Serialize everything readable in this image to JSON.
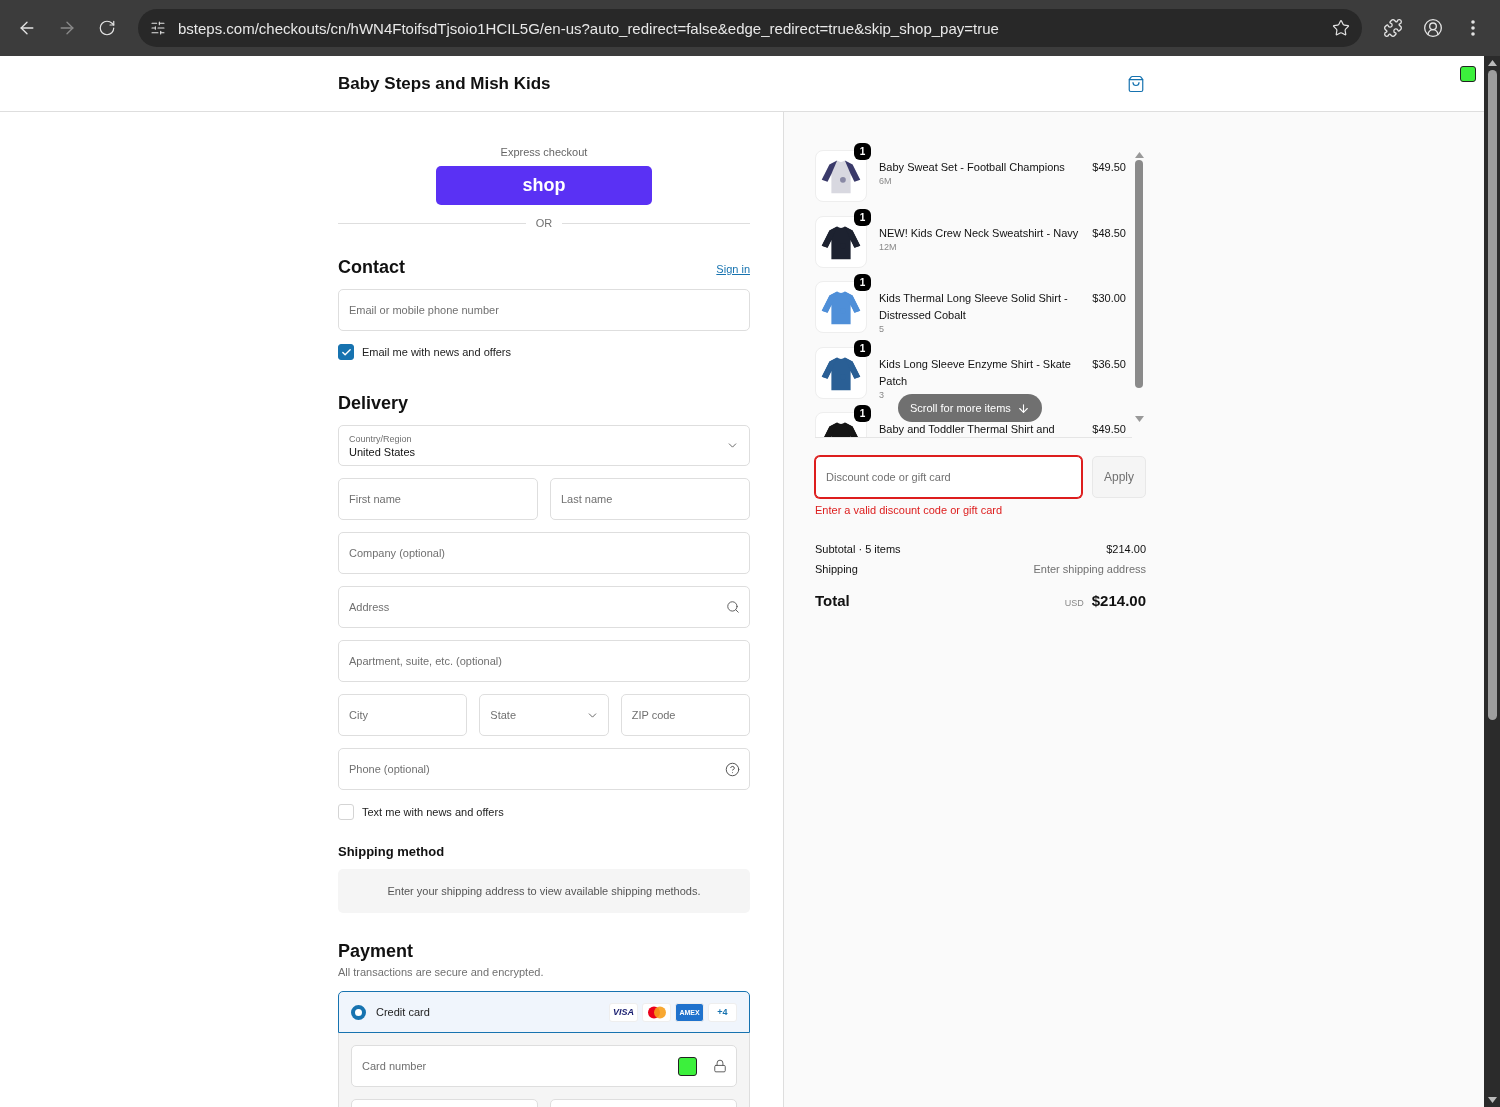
{
  "browser": {
    "url": "bsteps.com/checkouts/cn/hWN4FtoifsdTjsoio1HCIL5G/en-us?auto_redirect=false&edge_redirect=true&skip_shop_pay=true"
  },
  "store": {
    "name": "Baby Steps and Mish Kids"
  },
  "express": {
    "label": "Express checkout",
    "button": "shop",
    "divider": "OR"
  },
  "contact": {
    "heading": "Contact",
    "sign_in": "Sign in",
    "email_placeholder": "Email or mobile phone number",
    "newsletter": {
      "label": "Email me with news and offers",
      "checked": true
    }
  },
  "delivery": {
    "heading": "Delivery",
    "country": {
      "label": "Country/Region",
      "value": "United States"
    },
    "rows": [
      [
        {
          "kind": "text",
          "placeholder": "First name"
        },
        {
          "kind": "text",
          "placeholder": "Last name"
        }
      ],
      [
        {
          "kind": "text",
          "placeholder": "Company (optional)"
        }
      ],
      [
        {
          "kind": "search",
          "placeholder": "Address"
        }
      ],
      [
        {
          "kind": "text",
          "placeholder": "Apartment, suite, etc. (optional)"
        }
      ],
      [
        {
          "kind": "text",
          "placeholder": "City"
        },
        {
          "kind": "select",
          "placeholder": "State"
        },
        {
          "kind": "text",
          "placeholder": "ZIP code"
        }
      ],
      [
        {
          "kind": "help",
          "placeholder": "Phone (optional)"
        }
      ]
    ],
    "sms": {
      "label": "Text me with news and offers",
      "checked": false
    }
  },
  "shipping_method": {
    "heading": "Shipping method",
    "message": "Enter your shipping address to view available shipping methods."
  },
  "payment": {
    "heading": "Payment",
    "subtitle": "All transactions are secure and encrypted.",
    "methods": [
      {
        "label": "Credit card",
        "selected": true,
        "logos": [
          {
            "kind": "visa",
            "text": "VISA"
          },
          {
            "kind": "mastercard"
          },
          {
            "kind": "amex",
            "text": "AMEX"
          },
          {
            "kind": "more",
            "text": "+4"
          }
        ]
      }
    ],
    "card_number_placeholder": "Card number"
  },
  "summary": {
    "items": [
      {
        "quantity": "1",
        "name": "Baby Sweat Set - Football Champions",
        "variant": "6M",
        "price": "$49.50"
      },
      {
        "quantity": "1",
        "name": "NEW! Kids Crew Neck Sweatshirt - Navy",
        "variant": "12M",
        "price": "$48.50"
      },
      {
        "quantity": "1",
        "name": "Kids Thermal Long Sleeve Solid Shirt - Distressed Cobalt",
        "variant": "5",
        "price": "$30.00"
      },
      {
        "quantity": "1",
        "name": "Kids Long Sleeve Enzyme Shirt - Skate Patch",
        "variant": "3",
        "price": "$36.50"
      },
      {
        "quantity": "1",
        "name": "Baby and Toddler Thermal Shirt and",
        "price": "$49.50"
      }
    ],
    "scroll_hint": "Scroll for more items",
    "discount": {
      "placeholder": "Discount code or gift card",
      "button": "Apply",
      "error": "Enter a valid discount code or gift card"
    },
    "subtotal_label": "Subtotal · 5 items",
    "subtotal": "$214.00",
    "shipping_label": "Shipping",
    "shipping": "Enter shipping address",
    "total_label": "Total",
    "currency": "USD",
    "total": "$214.00"
  }
}
